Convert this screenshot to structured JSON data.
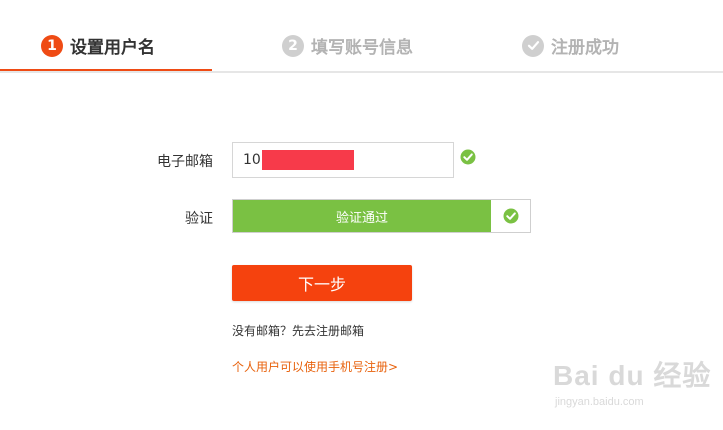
{
  "steps": [
    {
      "num": "1",
      "label": "设置用户名"
    },
    {
      "num": "2",
      "label": "填写账号信息"
    },
    {
      "label": "注册成功"
    }
  ],
  "form": {
    "email_label": "电子邮箱",
    "email_value": "10            om",
    "verify_label": "验证",
    "verify_status": "验证通过",
    "next_button": "下一步"
  },
  "links": {
    "no_email": "没有邮箱？先去注册邮箱",
    "phone_register": "个人用户可以使用手机号注册>"
  },
  "watermark": {
    "logo": "Bai du 经验",
    "url": "jingyan.baidu.com"
  },
  "colors": {
    "accent": "#ef4b14",
    "success": "#7ac143",
    "link": "#e8620d"
  }
}
